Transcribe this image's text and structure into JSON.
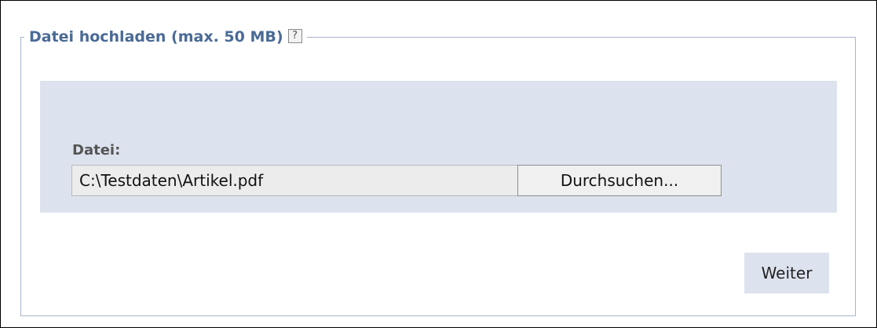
{
  "upload": {
    "legend": "Datei hochladen (max. 50 MB)",
    "help_icon": "?",
    "help_icon_name": "help-icon",
    "file_label": "Datei:",
    "file_value": "C:\\Testdaten\\Artikel.pdf",
    "browse_label": "Durchsuchen..."
  },
  "actions": {
    "next_label": "Weiter"
  },
  "colors": {
    "legend_text": "#4a6a96",
    "panel_background": "#dde3ee",
    "fieldset_border": "#a9b4cc"
  }
}
